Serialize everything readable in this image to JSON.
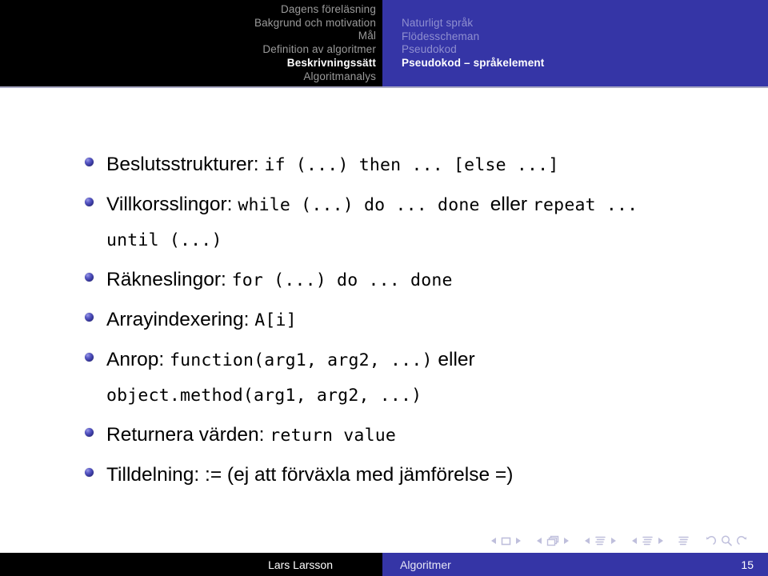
{
  "headline": {
    "left_nav": [
      {
        "label": "Dagens föreläsning",
        "current": false
      },
      {
        "label": "Bakgrund och motivation",
        "current": false
      },
      {
        "label": "Mål",
        "current": false
      },
      {
        "label": "Definition av algoritmer",
        "current": false
      },
      {
        "label": "Beskrivningssätt",
        "current": true
      },
      {
        "label": "Algoritmanalys",
        "current": false
      }
    ],
    "right_nav": [
      {
        "label": "Naturligt språk",
        "current": false
      },
      {
        "label": "Flödesscheman",
        "current": false
      },
      {
        "label": "Pseudokod",
        "current": false
      },
      {
        "label": "Pseudokod – språkelement",
        "current": true
      }
    ],
    "colors": {
      "left_bg": "#000000",
      "right_bg": "#3535a6",
      "rule": "#a9a9c4",
      "inactive_left": "#9a9a9a",
      "inactive_right": "#8f8fd0",
      "active": "#ffffff"
    }
  },
  "content": {
    "bullet_color": "#3636a0",
    "items": [
      {
        "lines": [
          [
            {
              "text": "Beslutsstrukturer: ",
              "mono": false
            },
            {
              "text": "if (...) then ... [else ...]",
              "mono": true
            }
          ]
        ]
      },
      {
        "lines": [
          [
            {
              "text": "Villkorsslingor: ",
              "mono": false
            },
            {
              "text": "while (...) do ... done ",
              "mono": true
            },
            {
              "text": "eller ",
              "mono": false
            },
            {
              "text": "repeat ...",
              "mono": true
            }
          ],
          [
            {
              "text": "until (...)",
              "mono": true
            }
          ]
        ]
      },
      {
        "lines": [
          [
            {
              "text": "Räkneslingor: ",
              "mono": false
            },
            {
              "text": "for (...) do ... done",
              "mono": true
            }
          ]
        ]
      },
      {
        "lines": [
          [
            {
              "text": "Arrayindexering: ",
              "mono": false
            },
            {
              "text": "A[i]",
              "mono": true
            }
          ]
        ]
      },
      {
        "lines": [
          [
            {
              "text": "Anrop: ",
              "mono": false
            },
            {
              "text": "function(arg1, arg2, ...)",
              "mono": true
            },
            {
              "text": " eller",
              "mono": false
            }
          ],
          [
            {
              "text": "object.method(arg1, arg2, ...)",
              "mono": true
            }
          ]
        ]
      },
      {
        "lines": [
          [
            {
              "text": "Returnera värden: ",
              "mono": false
            },
            {
              "text": "return value",
              "mono": true
            }
          ]
        ]
      },
      {
        "lines": [
          [
            {
              "text": "Tilldelning: := (ej att förväxla med jämförelse =)",
              "mono": false
            }
          ]
        ]
      }
    ]
  },
  "navigation_symbols": {
    "color": "#bfbfdc",
    "groups": [
      {
        "name": "slide",
        "icons": [
          "prev-slide-icon",
          "slide-icon",
          "next-slide-icon"
        ]
      },
      {
        "name": "frame",
        "icons": [
          "prev-frame-icon",
          "frame-icon",
          "next-frame-icon"
        ]
      },
      {
        "name": "subsection",
        "icons": [
          "prev-subsection-icon",
          "subsection-icon",
          "next-subsection-icon"
        ]
      },
      {
        "name": "section",
        "icons": [
          "prev-section-icon",
          "section-icon",
          "next-section-icon"
        ]
      },
      {
        "name": "doc",
        "icons": [
          "document-icon"
        ]
      },
      {
        "name": "misc",
        "icons": [
          "back-icon",
          "search-icon",
          "forward-icon"
        ]
      }
    ]
  },
  "footline": {
    "author": "Lars Larsson",
    "title": "Algoritmer",
    "page": "15",
    "colors": {
      "author_bg": "#000000",
      "title_bg": "#3535a6"
    }
  }
}
